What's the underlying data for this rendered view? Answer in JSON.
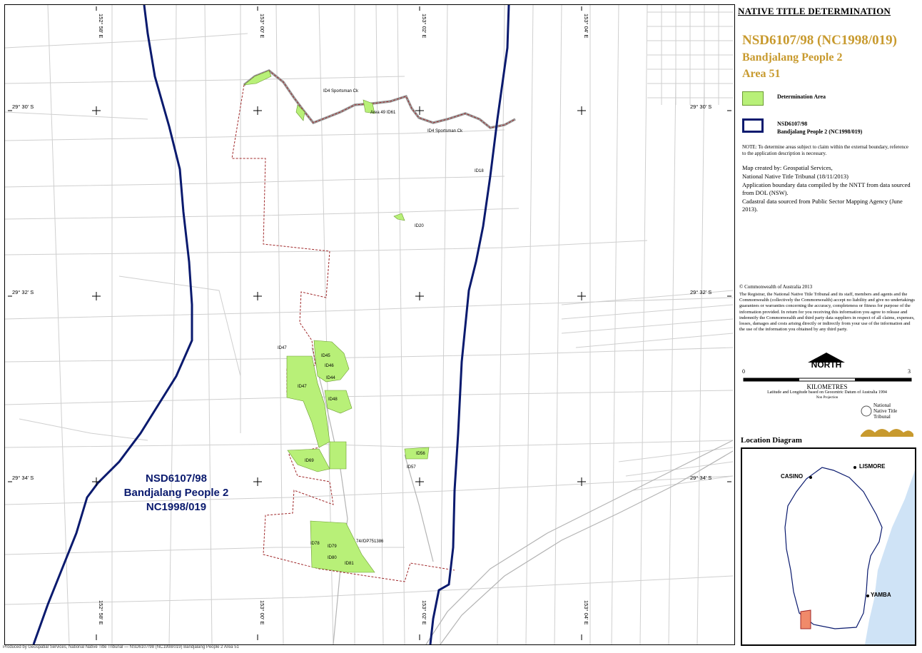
{
  "panel": {
    "title": "NATIVE TITLE DETERMINATION",
    "heading": "NSD6107/98 (NC1998/019)",
    "claim_name": "Bandjalang People 2",
    "area": "Area 51",
    "legend": [
      {
        "label": "Determination Area",
        "color": "#b8f078"
      },
      {
        "label": "NSD6107/98\nBandjalang People 2 (NC1998/019)",
        "color": "#0a1a6e"
      }
    ],
    "note": "NOTE: To determine areas subject to claim within the external boundary, reference to the application description is necessary.",
    "credits": [
      "Map created by: Geospatial Services,",
      "National Native Title Tribunal   (18/11/2013)",
      "Application boundary data compiled by the NNTT from data sourced from DOL (NSW).",
      "Cadastral data sourced from Public Sector Mapping Agency (June 2013)."
    ],
    "copyright": "© Commonwealth of Australia 2013",
    "disclaimer": "The Registrar, the National Native Title Tribunal and its staff, members and agents and the Commonwealth (collectively the Commonwealth) accept no liability and give no undertakings guarantees or warranties concerning the accuracy, completeness or fitness for purpose of the information provided. In return for you receiving this information you agree to release and indemnify the Commonwealth and third party data suppliers in respect of all claims, expenses, losses, damages and costs arising directly or indirectly from your use of the information and the use of the information you obtained by any third party.",
    "north": "NORTH",
    "scale": {
      "min": "0",
      "max": "3",
      "unit": "KILOMETRES"
    },
    "datum": "Latitude and Longitude based on Geocentric Datum of Australia 1994",
    "projection": "Non Projection",
    "tribunal_name": "National\nNative Title\nTribunal",
    "location_title": "Location Diagram",
    "towns": [
      "CASINO",
      "LISMORE",
      "YAMBA"
    ]
  },
  "map": {
    "claim_label": [
      "NSD6107/98",
      "Bandjalang People 2",
      "NC1998/019"
    ],
    "lat_labels": [
      "29° 30' S",
      "29° 32' S",
      "29° 34' S"
    ],
    "lon_labels": [
      "152° 58' E",
      "153° 00' E",
      "153° 02' E",
      "153° 04' E"
    ],
    "parcels": [
      "ID4 Sportsman Ck",
      "Area 49 ID61",
      "ID4 Sportsman Ck",
      "ID18",
      "ID20",
      "ID47",
      "ID45",
      "ID46",
      "ID44",
      "ID47",
      "ID48",
      "ID69",
      "ID56",
      "ID57",
      "ID78",
      "ID79",
      "ID80",
      "ID81",
      "74//DP751386"
    ],
    "colors": {
      "determination": "#b8f078",
      "claim_boundary": "#0a1a6e",
      "cadastre": "#c8c8c8",
      "area_boundary": "#a0282a",
      "accent": "#c89a2e"
    }
  },
  "footer": "Produced by Geospatial Services, National Native Title Tribunal — NSD6107/98 (NC1998/019) Bandjalang People 2 Area 51"
}
